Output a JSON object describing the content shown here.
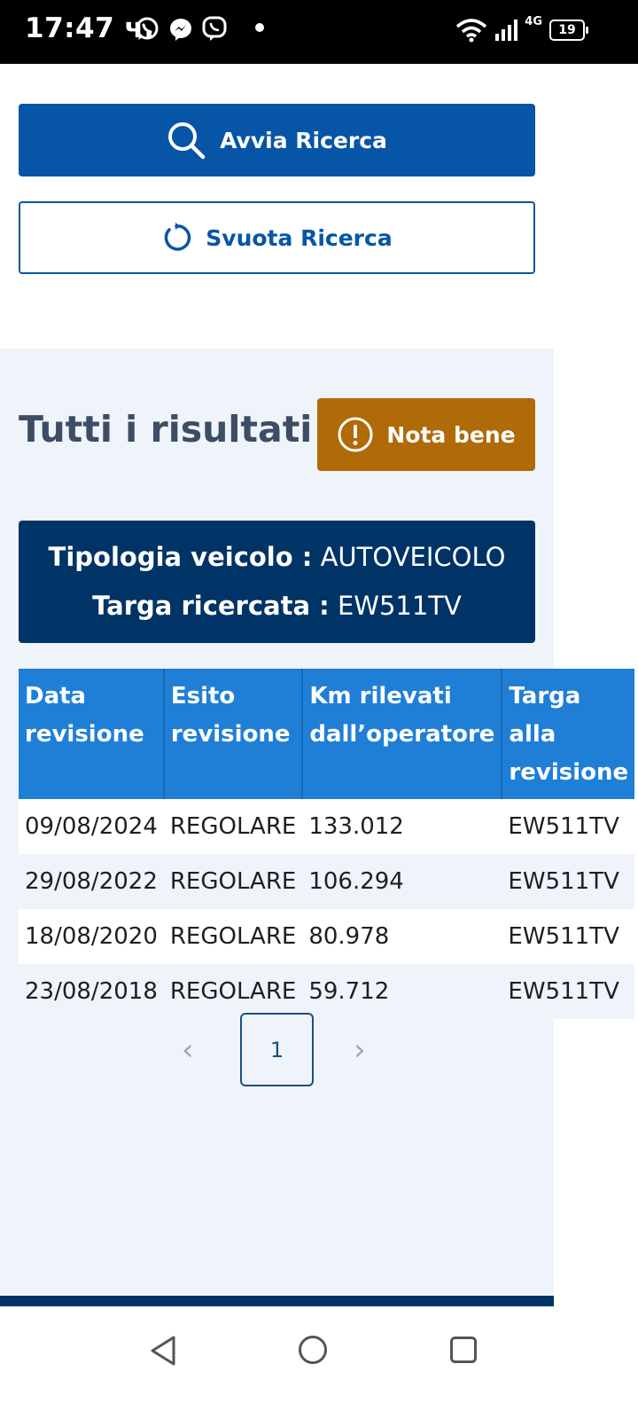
{
  "status_bar": {
    "time": "17:47 ч.",
    "app_icons": [
      "whatsapp-icon",
      "messenger-icon",
      "viber-icon"
    ],
    "network": "4G",
    "battery": "19"
  },
  "search": {
    "start_label": "Avvia Ricerca",
    "clear_label": "Svuota Ricerca"
  },
  "results": {
    "title": "Tutti i risultati",
    "note_label": "Nota bene",
    "vehicle_type_label": "Tipologia veicolo :",
    "vehicle_type_value": "AUTOVEICOLO",
    "plate_label": "Targa ricercata :",
    "plate_value": "EW511TV"
  },
  "table": {
    "columns": [
      [
        "Data",
        "revisione"
      ],
      [
        "Esito",
        "revisione"
      ],
      [
        "Km rilevati",
        "dall’operatore"
      ],
      [
        "Targa alla",
        "revisione"
      ]
    ],
    "rows": [
      [
        "09/08/2024",
        "REGOLARE",
        "133.012",
        "EW511TV"
      ],
      [
        "29/08/2022",
        "REGOLARE",
        "106.294",
        "EW511TV"
      ],
      [
        "18/08/2020",
        "REGOLARE",
        "80.978",
        "EW511TV"
      ],
      [
        "23/08/2018",
        "REGOLARE",
        "59.712",
        "EW511TV"
      ]
    ]
  },
  "pagination": {
    "current": "1",
    "prev": "‹",
    "next": "›"
  },
  "colors": {
    "primary": "#0755a6",
    "dark_blue": "#003366",
    "warning": "#b16a08",
    "table_header": "#1f7fd6",
    "panel_bg": "#eff4fa"
  }
}
